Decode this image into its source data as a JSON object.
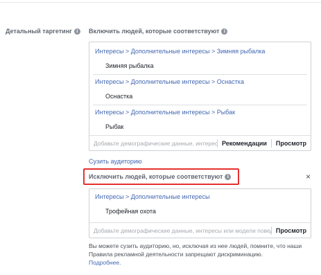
{
  "targeting_label": "Детальный таргетинг",
  "include": {
    "title": "Включить людей, которые соответствуют",
    "groups": [
      {
        "path": "Интересы > Дополнительные интересы > Зимняя рыбалка",
        "selected": "Зимняя рыбалка"
      },
      {
        "path": "Интересы > Дополнительные интересы > Оснастка",
        "selected": "Оснастка"
      },
      {
        "path": "Интересы > Дополнительные интересы > Рыбак",
        "selected": "Рыбак"
      }
    ],
    "search_placeholder": "Добавьте демографические данные, интересы или модели поведения",
    "recommendations_label": "Рекомендации",
    "browse_label": "Просмотр"
  },
  "narrow_link": "Сузить аудиторию",
  "exclude": {
    "title": "Исключить людей, которые соответствуют",
    "groups": [
      {
        "path": "Интересы > Дополнительные интересы",
        "selected": "Трофейная охота"
      }
    ],
    "search_placeholder": "Добавьте демографические данные, интересы или модели поведения",
    "browse_label": "Просмотр",
    "close_symbol": "×"
  },
  "note": {
    "text": "Вы можете сузить аудиторию, но, исключая из нее людей, помните, что наши Правила рекламной деятельности запрещают дискриминацию.",
    "more_link": "Подробнее."
  },
  "icons": {
    "info": "info-icon",
    "close": "close-icon"
  },
  "colors": {
    "link": "#4267b2",
    "highlight": "#e5312e",
    "border": "#ccd0d5",
    "label": "#606770"
  }
}
